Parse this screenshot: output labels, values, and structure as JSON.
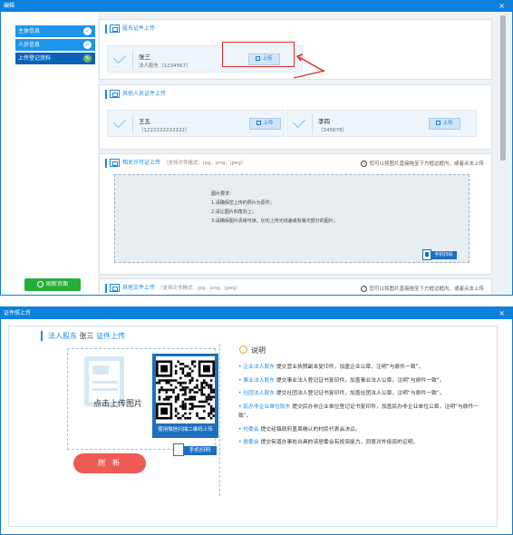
{
  "dialog1": {
    "title": "编辑",
    "close": "×",
    "sidebar": [
      {
        "label": "主体信息",
        "state": "check"
      },
      {
        "label": "人员信息",
        "state": "check"
      },
      {
        "label": "上传登记资料",
        "state": "edit"
      }
    ],
    "refresh_label": "刷新页面",
    "shareholder_section": {
      "title": "股东证件上传",
      "person": {
        "name": "张三",
        "role_id": "法人股东（1234567）",
        "upload_label": "上传"
      }
    },
    "other_section": {
      "title": "其他人员证件上传",
      "people": [
        {
          "name": "王五",
          "id": "（1222222222222）",
          "upload_label": "上传"
        },
        {
          "name": "李四",
          "id": "（345678）",
          "upload_label": "上传"
        }
      ]
    },
    "license_section": {
      "title": "相关许可证上传",
      "formats": "（支持文件格式：jpg、png、jpeg）",
      "hint": "您可以将图片直接拖至下方框边框内，或者点击上传",
      "requirements": [
        "图片要求：",
        "1.请确保您上传的照片为原件；",
        "2.请让图片四角向上；",
        "3.请确保图片清晰可读，切勿上传光线差或有暴光部分的图片；"
      ],
      "phone_upload": "手机扫码"
    },
    "other_files_section": {
      "title": "其他文件上传",
      "formats": "（支持文件格式：jpg、png、jpeg）",
      "hint": "您可以将图片直接拖至下方框边框内，或者点击上传"
    }
  },
  "dialog2": {
    "title": "证件照上传",
    "close": "×",
    "heading_role": "法人股东",
    "heading_name": "张三",
    "heading_suffix": "证件上传",
    "photo_label": "点击上传图片",
    "qr_caption": "使用微信扫描二维码上传",
    "phone_upload": "手机扫码",
    "refresh": "刷新",
    "explain_title": "说明",
    "explain": [
      {
        "key": "• 企业法人股东",
        "text": " 提交营业执照副本复印件，加盖企业公章，注明“与原件一致”。"
      },
      {
        "key": "• 事业法人股东",
        "text": " 提交事业法人登记证书复印件，加盖事业法人公章，注明“与原件一致”。"
      },
      {
        "key": "• 社团法人股东",
        "text": " 提交社团法人登记证书复印件，加盖社团法人公章，注明“与原件一致”。"
      },
      {
        "key": "• 民办非企业单位股东",
        "text": " 提交民办非企业单位登记证书复印件，加盖民办非企业单位公章，注明“与原件一致”。"
      },
      {
        "key": "• 村委会",
        "text": " 提交经镇政府盖章确认的村民代表会决议。"
      },
      {
        "key": "• 居委会",
        "text": " 提交街道办事处出具的该居委会有投资能力，同意对外投资的证明。"
      }
    ]
  },
  "colors": {
    "primary": "#1d8ae6",
    "titlebar": "#0b82e0",
    "success": "#27ae3a",
    "danger": "#ef5a55",
    "annotation": "#e02828"
  }
}
